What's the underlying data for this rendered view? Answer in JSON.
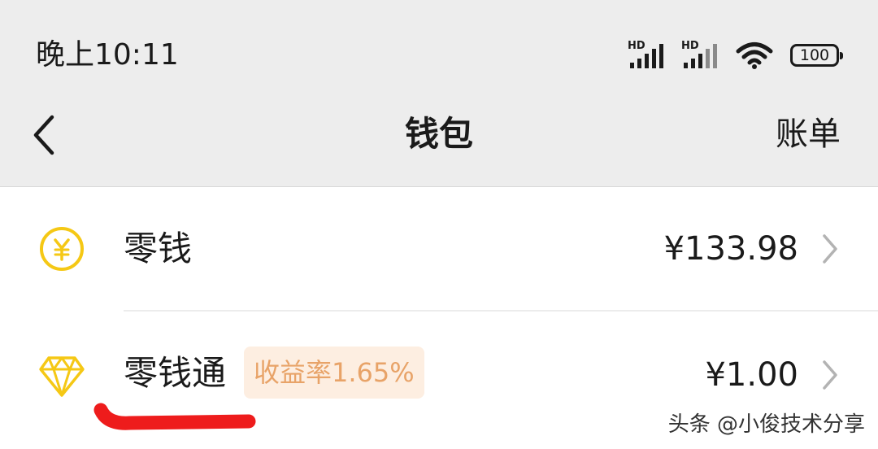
{
  "status_bar": {
    "time": "晚上10:11",
    "signal_1_label": "HD",
    "signal_2_label": "HD",
    "battery_level": "100",
    "icons": [
      "signal-hd-icon",
      "signal-hd-icon",
      "wifi-icon",
      "battery-icon"
    ]
  },
  "nav": {
    "back_icon": "back-chevron-icon",
    "title": "钱包",
    "bill_label": "账单"
  },
  "wallet_items": [
    {
      "icon": "yuan-coin-icon",
      "label": "零钱",
      "amount": "¥133.98",
      "chevron_icon": "chevron-right-icon"
    },
    {
      "icon": "diamond-icon",
      "label": "零钱通",
      "badge": "收益率1.65%",
      "amount": "¥1.00",
      "chevron_icon": "chevron-right-icon"
    }
  ],
  "watermark": "头条 @小俊技术分享",
  "colors": {
    "header_bg": "#ededed",
    "icon_yellow": "#f5c815",
    "badge_bg": "#fdeee1",
    "badge_text": "#e8a368",
    "annotation_red": "#ee1c1c"
  }
}
